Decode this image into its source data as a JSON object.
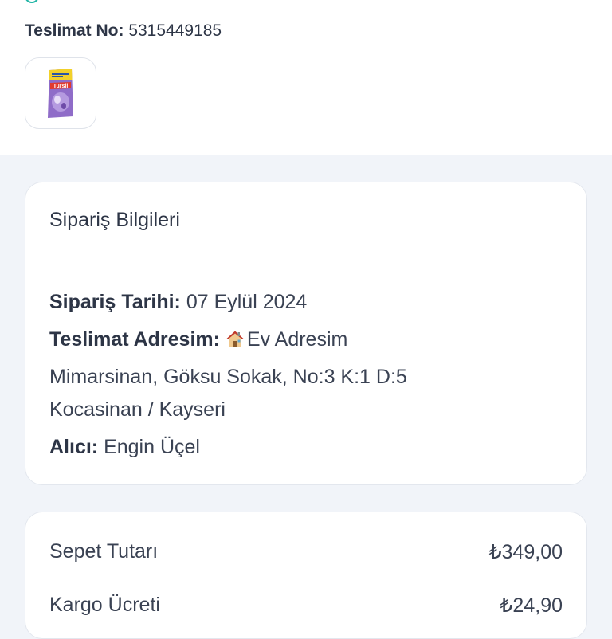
{
  "header": {
    "delivery_label": "Teslimat No:",
    "delivery_number": "5315449185"
  },
  "product": {
    "image_icon": "detergent-package",
    "brand": "Tursil"
  },
  "order_info": {
    "title": "Sipariş Bilgileri",
    "date_label": "Sipariş Tarihi:",
    "date_value": "07 Eylül 2024",
    "address_label": "Teslimat Adresim:",
    "address_name": "Ev Adresim",
    "address_icon": "house-icon",
    "address_line1": "Mimarsinan, Göksu Sokak, No:3 K:1 D:5",
    "address_line2": "Kocasinan / Kayseri",
    "recipient_label": "Alıcı:",
    "recipient_value": "Engin Üçel"
  },
  "summary": {
    "rows": [
      {
        "label": "Sepet Tutarı",
        "value": "₺349,00"
      },
      {
        "label": "Kargo Ücreti",
        "value": "₺24,90"
      }
    ]
  },
  "colors": {
    "accent": "#22b5a6",
    "page_bg": "#f1f4f9",
    "card_bg": "#ffffff"
  }
}
